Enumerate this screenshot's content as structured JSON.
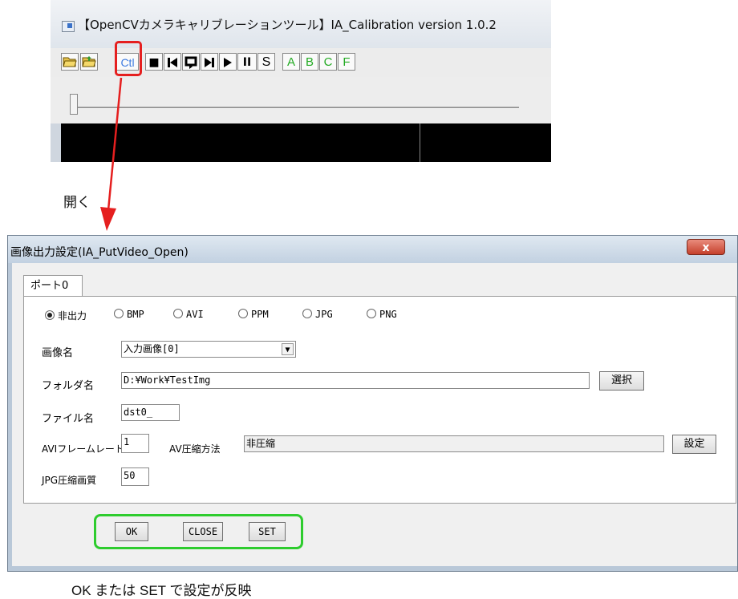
{
  "app_window": {
    "title": "【OpenCVカメラキャリブレーションツール】IA_Calibration version 1.0.2",
    "toolbar": [
      {
        "name": "open-folder-button",
        "icon": "open-folder-icon",
        "label": ""
      },
      {
        "name": "save-folder-button",
        "icon": "save-folder-icon",
        "label": ""
      },
      {
        "name": "ctl-button",
        "icon": "",
        "label": "Ctl"
      },
      {
        "name": "stop-button",
        "icon": "stop-icon",
        "label": "■"
      },
      {
        "name": "skip-back-button",
        "icon": "skip-back-icon",
        "label": "⏮"
      },
      {
        "name": "loop-button",
        "icon": "loop-icon",
        "label": "⟲"
      },
      {
        "name": "skip-forward-button",
        "icon": "skip-forward-icon",
        "label": "⏭"
      },
      {
        "name": "play-button",
        "icon": "play-icon",
        "label": "▶"
      },
      {
        "name": "pause-button",
        "icon": "pause-icon",
        "label": "II"
      },
      {
        "name": "s-button",
        "icon": "",
        "label": "S"
      },
      {
        "name": "a-button",
        "icon": "",
        "label": "A"
      },
      {
        "name": "b-button",
        "icon": "",
        "label": "B"
      },
      {
        "name": "c-button",
        "icon": "",
        "label": "C"
      },
      {
        "name": "f-button",
        "icon": "",
        "label": "F"
      }
    ],
    "slider_value": 0
  },
  "annotations": {
    "open_label": "開く",
    "bottom_note": "OK または SET で設定が反映",
    "highlight_color": "#e51f1f",
    "ok_highlight_color": "#2ecc2e"
  },
  "dialog": {
    "title": "画像出力設定(IA_PutVideo_Open)",
    "close_label": "x",
    "tab_label": "ポート0",
    "radio_options": [
      "非出力",
      "BMP",
      "AVI",
      "PPM",
      "JPG",
      "PNG"
    ],
    "selected_radio": "非出力",
    "image_name_label": "画像名",
    "image_name_value": "入力画像[0]",
    "folder_label": "フォルダ名",
    "folder_value": "D:¥Work¥TestImg",
    "select_button": "選択",
    "file_label": "ファイル名",
    "file_value": "dst0_",
    "fps_label": "AVIフレームレート",
    "fps_value": "1",
    "compress_label": "AV圧縮方法",
    "compress_value": "非圧縮",
    "settings_button": "設定",
    "jpg_label": "JPG圧縮画質",
    "jpg_value": "50",
    "ok_button": "OK",
    "close_button": "CLOSE",
    "set_button": "SET"
  }
}
